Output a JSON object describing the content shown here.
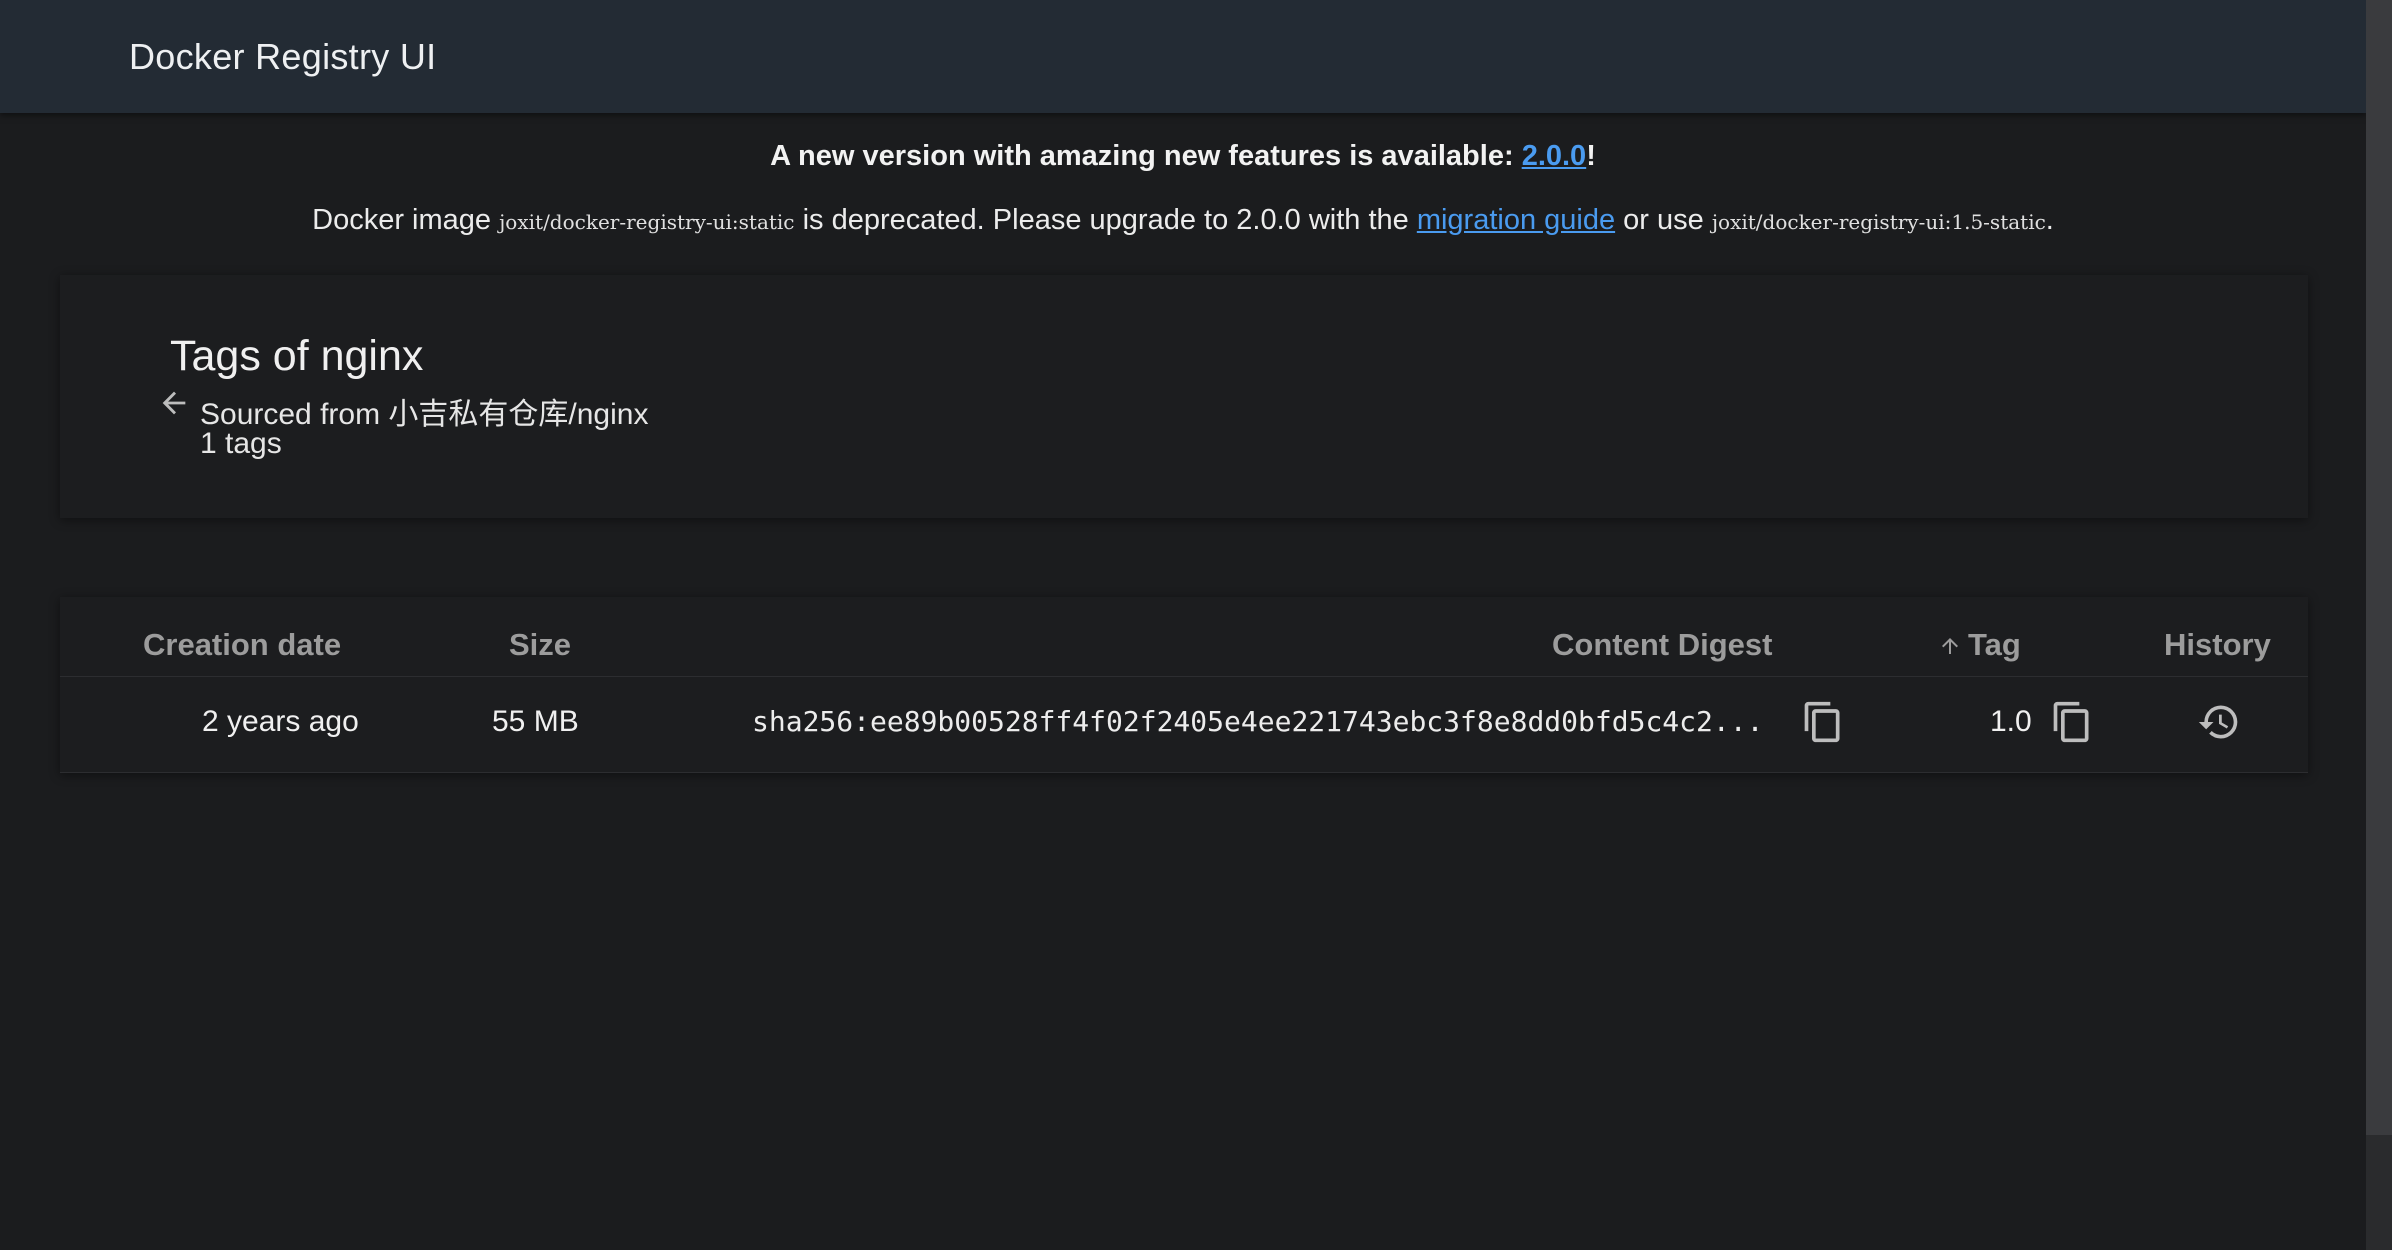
{
  "header": {
    "title": "Docker Registry UI"
  },
  "banner": {
    "line1_prefix": "A new version with amazing new features is available: ",
    "line1_link": "2.0.0",
    "line1_suffix": "!",
    "line2_prefix": "Docker image ",
    "line2_code1": "joxit/docker-registry-ui:static",
    "line2_middle": " is deprecated. Please upgrade to 2.0.0 with the ",
    "line2_link": "migration guide",
    "line2_after_link": " or use ",
    "line2_code2": "joxit/docker-registry-ui:1.5-static",
    "line2_end": "."
  },
  "info": {
    "title": "Tags of nginx",
    "sourced": "Sourced from 小吉私有仓库/nginx",
    "count": "1 tags"
  },
  "table": {
    "columns": {
      "creation_date": "Creation date",
      "size": "Size",
      "content_digest": "Content Digest",
      "tag": "Tag",
      "history": "History"
    },
    "rows": [
      {
        "creation_date": "2 years ago",
        "size": "55 MB",
        "digest": "sha256:ee89b00528ff4f02f2405e4ee221743ebc3f8e8dd0bfd5c4c2...",
        "tag": "1.0"
      }
    ]
  },
  "icons": {
    "back": "arrow-left-icon",
    "sort": "arrow-up-icon",
    "copy": "content-copy-icon",
    "history": "history-icon"
  },
  "colors": {
    "header_bg": "#232b34",
    "page_bg": "#1b1c1e",
    "link": "#4a9bf0"
  }
}
